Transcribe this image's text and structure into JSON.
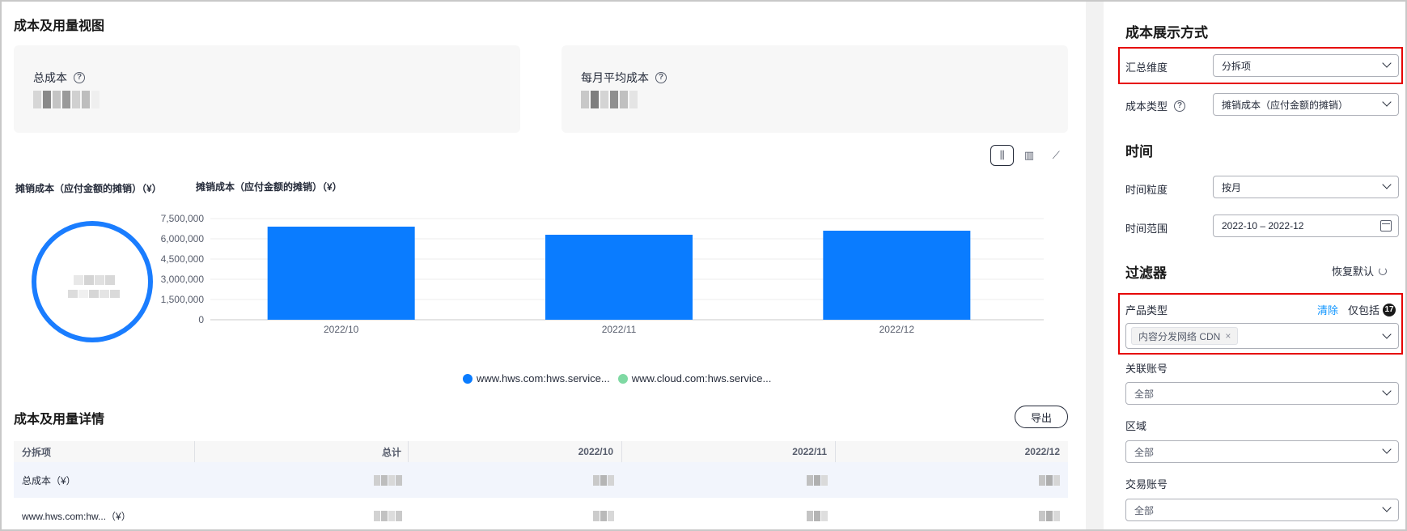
{
  "main": {
    "title": "成本及用量视图",
    "cards": [
      {
        "label": "总成本",
        "help": "?"
      },
      {
        "label": "每月平均成本",
        "help": "?"
      }
    ],
    "chart_toggle": [
      {
        "icon": "grouped-bar-chart-icon",
        "glyph": "⫼",
        "active": true
      },
      {
        "icon": "stacked-bar-chart-icon",
        "glyph": "▥",
        "active": false
      },
      {
        "icon": "line-chart-icon",
        "glyph": "⟋",
        "active": false
      }
    ],
    "ring_title": "摊销成本（应付金额的摊销）（¥）",
    "bar_title": "摊销成本（应付金额的摊销）（¥）",
    "legend": [
      {
        "name": "www.hws.com:hws.service...",
        "color": "#0a7cff"
      },
      {
        "name": "www.cloud.com:hws.service...",
        "color": "#7fd9a3"
      }
    ],
    "detail_title": "成本及用量详情",
    "export_label": "导出",
    "table": {
      "headers": [
        "分拆项",
        "总计",
        "2022/10",
        "2022/11",
        "2022/12"
      ],
      "rows": [
        {
          "label": "总成本（¥）"
        },
        {
          "label": "www.hws.com:hw...（¥）"
        }
      ]
    }
  },
  "chart_data": {
    "type": "bar",
    "title": "摊销成本（应付金额的摊销）（¥）",
    "categories": [
      "2022/10",
      "2022/11",
      "2022/12"
    ],
    "values": [
      6900000,
      6300000,
      6600000
    ],
    "ylim": [
      0,
      7500000
    ],
    "yticks": [
      0,
      1500000,
      3000000,
      4500000,
      6000000,
      7500000
    ],
    "ytick_labels": [
      "0",
      "1,500,000",
      "3,000,000",
      "4,500,000",
      "6,000,000",
      "7,500,000"
    ],
    "bar_color": "#0a7cff",
    "grid": true
  },
  "panel": {
    "display_title": "成本展示方式",
    "summary_dimension": {
      "label": "汇总维度",
      "value": "分拆项"
    },
    "cost_type": {
      "label": "成本类型",
      "help": "?",
      "value": "摊销成本（应付金额的摊销）"
    },
    "time_title": "时间",
    "time_granularity": {
      "label": "时间粒度",
      "value": "按月"
    },
    "time_range": {
      "label": "时间范围",
      "value": "2022-10 – 2022-12"
    },
    "filter_title": "过滤器",
    "reset_label": "恢复默认",
    "product_type": {
      "label": "产品类型",
      "clear": "清除",
      "only_include": "仅包括",
      "badge": "17",
      "tag": "内容分发网络 CDN",
      "tag_remove": "×"
    },
    "linked_account": {
      "label": "关联账号",
      "value": "全部"
    },
    "region": {
      "label": "区域",
      "value": "全部"
    },
    "trade_account": {
      "label": "交易账号",
      "value": "全部"
    }
  }
}
